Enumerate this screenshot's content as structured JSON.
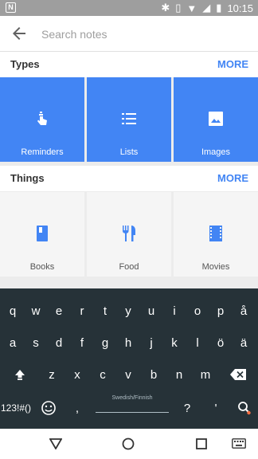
{
  "status": {
    "time": "10:15"
  },
  "search": {
    "placeholder": "Search notes"
  },
  "types": {
    "title": "Types",
    "more": "MORE",
    "items": [
      {
        "label": "Reminders",
        "icon": "reminder-hand-icon"
      },
      {
        "label": "Lists",
        "icon": "list-icon"
      },
      {
        "label": "Images",
        "icon": "image-icon"
      }
    ]
  },
  "things": {
    "title": "Things",
    "more": "MORE",
    "items": [
      {
        "label": "Books",
        "icon": "book-icon"
      },
      {
        "label": "Food",
        "icon": "food-icon"
      },
      {
        "label": "Movies",
        "icon": "movie-icon"
      }
    ]
  },
  "keyboard": {
    "row1": [
      "q",
      "w",
      "e",
      "r",
      "t",
      "y",
      "u",
      "i",
      "o",
      "p",
      "å"
    ],
    "row2": [
      "a",
      "s",
      "d",
      "f",
      "g",
      "h",
      "j",
      "k",
      "l",
      "ö",
      "ä"
    ],
    "row3": [
      "z",
      "x",
      "c",
      "v",
      "b",
      "n",
      "m"
    ],
    "symbols_label": "123!#()",
    "comma": ",",
    "space_label": "Swedish/Finnish",
    "question": "?",
    "apostrophe": "'"
  },
  "colors": {
    "accent": "#4285f4",
    "keyboard_bg": "#263238"
  }
}
